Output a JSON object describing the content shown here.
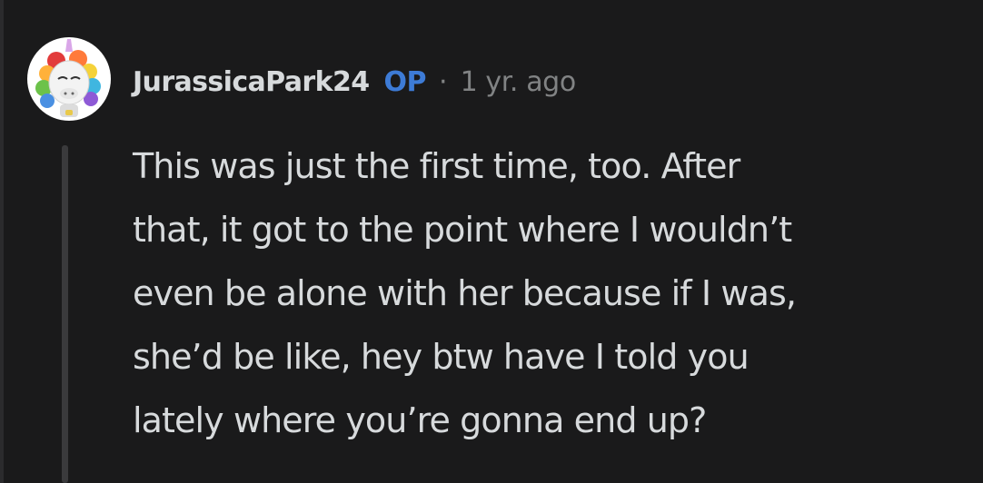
{
  "comment": {
    "author": "JurassicaPark24",
    "badge": "OP",
    "separator": "·",
    "timestamp": "1 yr. ago",
    "body_lines": [
      "This was just the first time, too. After",
      "that, it got to the point where I wouldn’t",
      "even be alone with her because if I was,",
      "she’d be like, hey btw have I told you",
      "lately where you’re gonna end up?"
    ]
  },
  "colors": {
    "background": "#1a1a1b",
    "username": "#d7dadc",
    "op_badge": "#3d7bd6",
    "meta": "#818384",
    "thread_line": "#3a3a3c"
  },
  "icons": {
    "avatar": "unicorn-avatar-icon"
  }
}
